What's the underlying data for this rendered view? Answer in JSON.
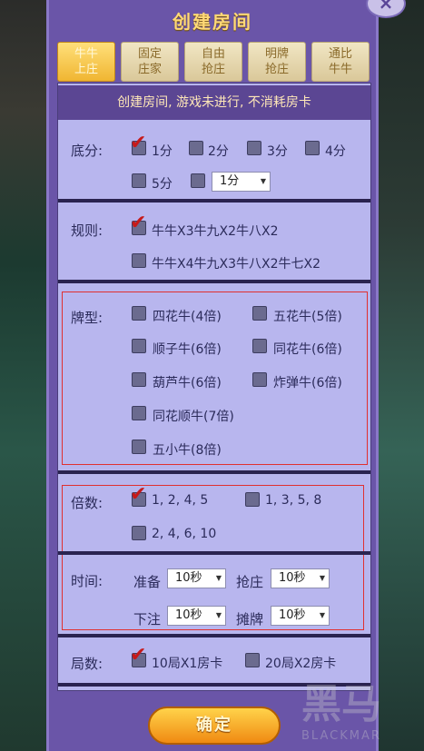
{
  "title": "创建房间",
  "close_label": "×",
  "tabs": [
    {
      "label": "牛牛 上庄"
    },
    {
      "label": "固定 庄家"
    },
    {
      "label": "自由 抢庄"
    },
    {
      "label": "明牌 抢庄"
    },
    {
      "label": "通比 牛牛"
    }
  ],
  "notice": "创建房间, 游戏未进行, 不消耗房卡",
  "base_score": {
    "label": "底分:",
    "options": [
      "1分",
      "2分",
      "3分",
      "4分",
      "5分"
    ],
    "selected": "1分",
    "select_value": "1分"
  },
  "rules": {
    "label": "规则:",
    "options": [
      "牛牛X3牛九X2牛八X2",
      "牛牛X4牛九X3牛八X2牛七X2"
    ],
    "selected": "牛牛X3牛九X2牛八X2"
  },
  "card_types": {
    "label": "牌型:",
    "options": [
      "四花牛(4倍)",
      "五花牛(5倍)",
      "顺子牛(6倍)",
      "同花牛(6倍)",
      "葫芦牛(6倍)",
      "炸弹牛(6倍)",
      "同花顺牛(7倍)",
      "五小牛(8倍)"
    ]
  },
  "multiplier": {
    "label": "倍数:",
    "options": [
      "1, 2, 4, 5",
      "1, 3, 5, 8",
      "2, 4, 6, 10"
    ],
    "selected": "1, 2, 4, 5"
  },
  "time": {
    "label": "时间:",
    "prepare_label": "准备",
    "prepare_value": "10秒",
    "grab_label": "抢庄",
    "grab_value": "10秒",
    "bet_label": "下注",
    "bet_value": "10秒",
    "show_label": "摊牌",
    "show_value": "10秒"
  },
  "rounds": {
    "label": "局数:",
    "options": [
      "10局X1房卡",
      "20局X2房卡"
    ],
    "selected": "10局X1房卡"
  },
  "confirm_label": "确定",
  "watermark": "黑马 BLACKMAR"
}
